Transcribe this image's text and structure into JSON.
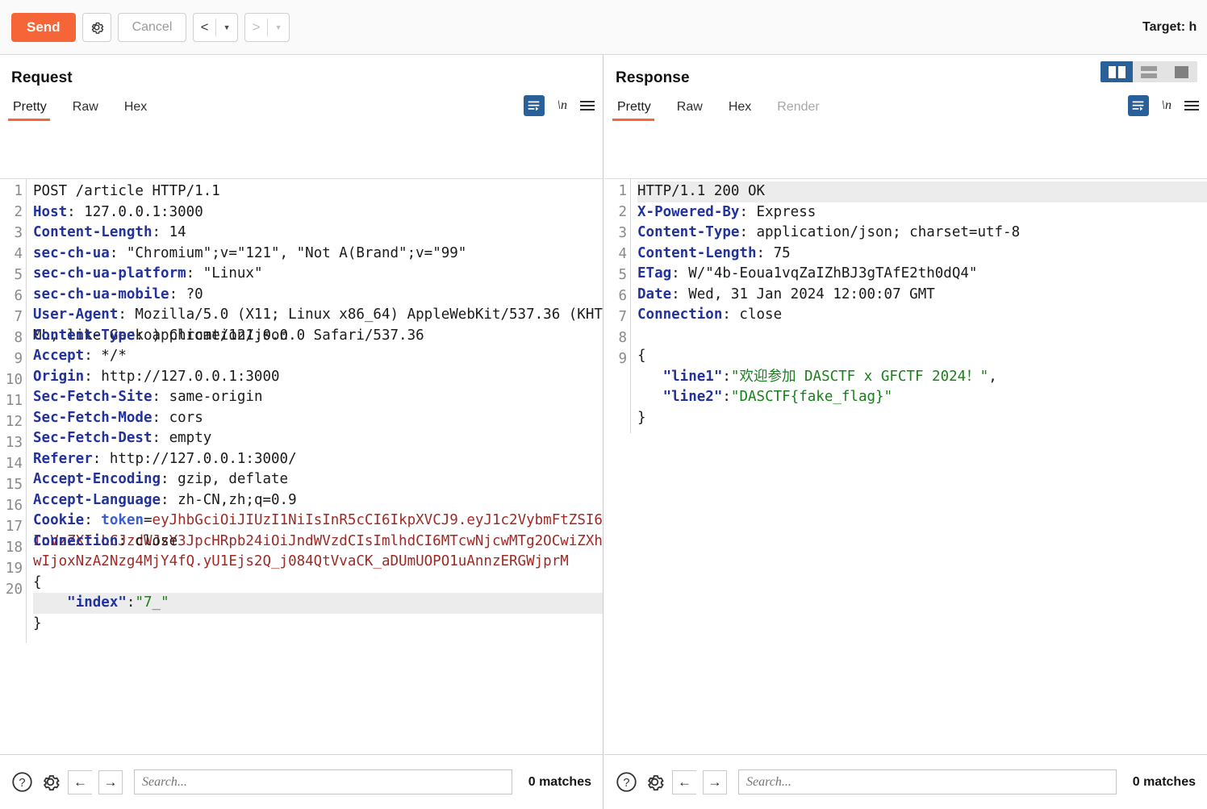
{
  "toolbar": {
    "send_label": "Send",
    "gear_icon": "gear-icon",
    "cancel_label": "Cancel",
    "prev_label": "<",
    "next_label": ">",
    "caret": "▼",
    "target_label": "Target: h"
  },
  "request": {
    "title": "Request",
    "tabs": [
      {
        "label": "Pretty",
        "active": true
      },
      {
        "label": "Raw",
        "active": false
      },
      {
        "label": "Hex",
        "active": false
      }
    ],
    "tools": {
      "wrap_icon": "word-wrap-icon",
      "newline_label": "\\n",
      "menu_icon": "hamburger-menu-icon"
    },
    "lines": [
      {
        "num": "1",
        "parts": [
          {
            "t": "val",
            "s": "POST /article HTTP/1.1"
          }
        ]
      },
      {
        "num": "2",
        "parts": [
          {
            "t": "hdr",
            "s": "Host"
          },
          {
            "t": "val",
            "s": ": 127.0.0.1:3000"
          }
        ]
      },
      {
        "num": "3",
        "parts": [
          {
            "t": "hdr",
            "s": "Content-Length"
          },
          {
            "t": "val",
            "s": ": 14"
          }
        ]
      },
      {
        "num": "4",
        "parts": [
          {
            "t": "hdr",
            "s": "sec-ch-ua"
          },
          {
            "t": "val",
            "s": ": \"Chromium\";v=\"121\", \"Not A(Brand\";v=\"99\""
          }
        ]
      },
      {
        "num": "5",
        "parts": [
          {
            "t": "hdr",
            "s": "sec-ch-ua-platform"
          },
          {
            "t": "val",
            "s": ": \"Linux\""
          }
        ]
      },
      {
        "num": "6",
        "parts": [
          {
            "t": "hdr",
            "s": "sec-ch-ua-mobile"
          },
          {
            "t": "val",
            "s": ": ?0"
          }
        ]
      },
      {
        "num": "7",
        "parts": [
          {
            "t": "hdr",
            "s": "User-Agent"
          },
          {
            "t": "val",
            "s": ": Mozilla/5.0 (X11; Linux x86_64) AppleWebKit/537.36 (KHTML, like Gecko) Chrome/121.0.0.0 Safari/537.36"
          }
        ]
      },
      {
        "num": "8",
        "parts": [
          {
            "t": "hdr",
            "s": "Content-Type"
          },
          {
            "t": "val",
            "s": ": application/json"
          }
        ]
      },
      {
        "num": "9",
        "parts": [
          {
            "t": "hdr",
            "s": "Accept"
          },
          {
            "t": "val",
            "s": ": */*"
          }
        ]
      },
      {
        "num": "10",
        "parts": [
          {
            "t": "hdr",
            "s": "Origin"
          },
          {
            "t": "val",
            "s": ": http://127.0.0.1:3000"
          }
        ]
      },
      {
        "num": "11",
        "parts": [
          {
            "t": "hdr",
            "s": "Sec-Fetch-Site"
          },
          {
            "t": "val",
            "s": ": same-origin"
          }
        ]
      },
      {
        "num": "12",
        "parts": [
          {
            "t": "hdr",
            "s": "Sec-Fetch-Mode"
          },
          {
            "t": "val",
            "s": ": cors"
          }
        ]
      },
      {
        "num": "13",
        "parts": [
          {
            "t": "hdr",
            "s": "Sec-Fetch-Dest"
          },
          {
            "t": "val",
            "s": ": empty"
          }
        ]
      },
      {
        "num": "14",
        "parts": [
          {
            "t": "hdr",
            "s": "Referer"
          },
          {
            "t": "val",
            "s": ": http://127.0.0.1:3000/"
          }
        ]
      },
      {
        "num": "15",
        "parts": [
          {
            "t": "hdr",
            "s": "Accept-Encoding"
          },
          {
            "t": "val",
            "s": ": gzip, deflate"
          }
        ]
      },
      {
        "num": "16",
        "parts": [
          {
            "t": "hdr",
            "s": "Accept-Language"
          },
          {
            "t": "val",
            "s": ": zh-CN,zh;q=0.9"
          }
        ]
      },
      {
        "num": "17",
        "parts": [
          {
            "t": "hdr",
            "s": "Cookie"
          },
          {
            "t": "val",
            "s": ": "
          },
          {
            "t": "hdr-sub",
            "s": "token"
          },
          {
            "t": "val",
            "s": "="
          },
          {
            "t": "jwt",
            "s": "eyJhbGciOiJIUzI1NiIsInR5cCI6IkpXVCJ9.eyJ1c2VybmFtZSI6InVzZXIiLCJzdWJzY3JpcHRpb24iOiJndWVzdCIsImlhdCI6MTcwNjcwMTg2OCwiZXhwIjoxNzA2Nzg4MjY4fQ.yU1Ejs2Q_j084QtVvaCK_aDUmUOPO1uAnnzERGWjprM"
          }
        ]
      },
      {
        "num": "18",
        "parts": [
          {
            "t": "hdr",
            "s": "Connection"
          },
          {
            "t": "val",
            "s": ": close"
          }
        ]
      },
      {
        "num": "19",
        "parts": []
      },
      {
        "num": "20",
        "parts": [
          {
            "t": "punc",
            "s": "{"
          }
        ]
      },
      {
        "num": "",
        "highlight": true,
        "parts": [
          {
            "t": "punc",
            "s": "    "
          },
          {
            "t": "jkey",
            "s": "\"index\""
          },
          {
            "t": "punc",
            "s": ":"
          },
          {
            "t": "jstr",
            "s": "\"7_\""
          }
        ]
      },
      {
        "num": "",
        "parts": [
          {
            "t": "punc",
            "s": "}"
          }
        ]
      }
    ],
    "search": {
      "help_icon": "help-icon",
      "gear_icon": "gear-icon",
      "prev_icon": "arrow-left-icon",
      "next_icon": "arrow-right-icon",
      "placeholder": "Search...",
      "value": "",
      "matches": "0 matches"
    }
  },
  "response": {
    "title": "Response",
    "tabs": [
      {
        "label": "Pretty",
        "active": true
      },
      {
        "label": "Raw",
        "active": false
      },
      {
        "label": "Hex",
        "active": false
      },
      {
        "label": "Render",
        "active": false,
        "disabled": true
      }
    ],
    "tools": {
      "wrap_icon": "word-wrap-icon",
      "newline_label": "\\n",
      "menu_icon": "hamburger-menu-icon"
    },
    "layout_toggles": [
      {
        "name": "layout-side-by-side",
        "active": true
      },
      {
        "name": "layout-stacked",
        "active": false
      },
      {
        "name": "layout-single",
        "active": false
      }
    ],
    "lines": [
      {
        "num": "1",
        "highlight": true,
        "parts": [
          {
            "t": "val",
            "s": "HTTP/1.1 200 OK"
          }
        ]
      },
      {
        "num": "2",
        "parts": [
          {
            "t": "hdr",
            "s": "X-Powered-By"
          },
          {
            "t": "val",
            "s": ": Express"
          }
        ]
      },
      {
        "num": "3",
        "parts": [
          {
            "t": "hdr",
            "s": "Content-Type"
          },
          {
            "t": "val",
            "s": ": application/json; charset=utf-8"
          }
        ]
      },
      {
        "num": "4",
        "parts": [
          {
            "t": "hdr",
            "s": "Content-Length"
          },
          {
            "t": "val",
            "s": ": 75"
          }
        ]
      },
      {
        "num": "5",
        "parts": [
          {
            "t": "hdr",
            "s": "ETag"
          },
          {
            "t": "val",
            "s": ": W/\"4b-Eoua1vqZaIZhBJ3gTAfE2th0dQ4\""
          }
        ]
      },
      {
        "num": "6",
        "parts": [
          {
            "t": "hdr",
            "s": "Date"
          },
          {
            "t": "val",
            "s": ": Wed, 31 Jan 2024 12:00:07 GMT"
          }
        ]
      },
      {
        "num": "7",
        "parts": [
          {
            "t": "hdr",
            "s": "Connection"
          },
          {
            "t": "val",
            "s": ": close"
          }
        ]
      },
      {
        "num": "8",
        "parts": []
      },
      {
        "num": "9",
        "parts": [
          {
            "t": "punc",
            "s": "{"
          }
        ]
      },
      {
        "num": "",
        "parts": [
          {
            "t": "punc",
            "s": "   "
          },
          {
            "t": "jkey",
            "s": "\"line1\""
          },
          {
            "t": "punc",
            "s": ":"
          },
          {
            "t": "jstr",
            "s": "\"欢迎参加 DASCTF x GFCTF 2024！\""
          },
          {
            "t": "punc",
            "s": ","
          }
        ]
      },
      {
        "num": "",
        "parts": [
          {
            "t": "punc",
            "s": "   "
          },
          {
            "t": "jkey",
            "s": "\"line2\""
          },
          {
            "t": "punc",
            "s": ":"
          },
          {
            "t": "jstr",
            "s": "\"DASCTF{fake_flag}\""
          }
        ]
      },
      {
        "num": "",
        "parts": [
          {
            "t": "punc",
            "s": "}"
          }
        ]
      }
    ],
    "search": {
      "help_icon": "help-icon",
      "gear_icon": "gear-icon",
      "prev_icon": "arrow-left-icon",
      "next_icon": "arrow-right-icon",
      "placeholder": "Search...",
      "value": "",
      "matches": "0 matches"
    }
  },
  "colors": {
    "accent_orange": "#f66538",
    "accent_blue": "#2a6099",
    "header_blue": "#22329c",
    "string_green": "#18801a",
    "jwt_red": "#9e2a26",
    "highlight_gray": "#ececec"
  }
}
